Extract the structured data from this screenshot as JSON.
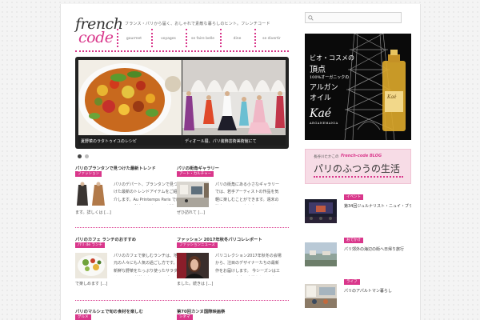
{
  "header": {
    "logo_line1": "french",
    "logo_line2": "code",
    "tagline": "フランス・パリから届く、おしゃれで素敵な暮らしのヒント。フレンチコード",
    "nav": [
      "gourmet",
      "voyages",
      "se faire belle",
      "dine",
      "se divertir"
    ]
  },
  "search": {
    "placeholder": ""
  },
  "slider": {
    "slides": [
      {
        "caption": "夏野菜のラタトゥイユのレシピ"
      },
      {
        "caption": "ディオール展、パリ装飾芸術美術館にて"
      }
    ]
  },
  "posts": [
    {
      "title": "パリのプランタンで見つけた最新トレンド",
      "category": "ファッション",
      "excerpt": "パリのデパート、プランタンで見つけた最新のトレンドアイテムをご紹介します。Au Printemps Paris では2017-18の秋冬コレクションが揃い、今年の注目アイテムがずらりと並んでい",
      "more": "ます。詳しくは",
      "more_link": "[...]"
    },
    {
      "title": "パリの街角ギャラリー",
      "category": "アート・カルチャー",
      "excerpt": "パリの街角にある小さなギャラリーでは、若手アーティストの作品を気軽に楽しむことができます。週末の散歩のついでに立ち寄ってみてはいかがでしょうか。入場無料の展示も多く",
      "more": "ぜひ訪れて",
      "more_link": "[...]"
    },
    {
      "title": "パリのカフェ ランチのおすすめ",
      "category": "パリ de ランチ",
      "excerpt": "パリのカフェで楽しむランチは、地元の人々にも人気の過ごし方です。 新鮮な野菜をたっぷり使ったサラダは12ユーロ前後から。テラス席でゆっくりと過ごす時間は19時頃ま",
      "more": "で楽しめます",
      "more_link": "[...]"
    },
    {
      "title": "ファッション 2017年秋冬パリコレレポート",
      "category": "ファッションニュース",
      "excerpt": "パリコレクション2017年秋冬の会場から、注目のデザイナーたちの最新作をお届けします。 今シーズンはエレガントで大人の女性らしいスタイルが主流となっており、多くのブランドがこぞって発表してい",
      "more": "ました。続きは",
      "more_link": "[...]"
    },
    {
      "title": "パリのマルシェで旬の食材を楽しむ",
      "category": "グルメ"
    },
    {
      "title": "第70回カンヌ国際映画祭",
      "category": "シネマ"
    }
  ],
  "ad": {
    "line1": "ビオ・コスメの",
    "line2": "頂点",
    "line3": "100%オーガニックの",
    "line4": "アルガン",
    "line5": "オイル",
    "brand": "Kaé",
    "brand_sub": "ARGANEMANIA",
    "bottle_label": "Kaé"
  },
  "blog": {
    "author": "長谷川たかこの",
    "name": "French-code BLOG",
    "title": "パリのふつうの生活"
  },
  "sidebar_posts": [
    {
      "category": "イベント",
      "title": "第34回ジュルナリスト・ニュイ・ブランシュ開催"
    },
    {
      "category": "おでかけ",
      "title": "パリ郊外の海辺の街へ日帰り旅行"
    },
    {
      "category": "ライフ",
      "title": "パリのアパルトマン暮らし"
    }
  ],
  "colors": {
    "accent": "#d9378b",
    "frame": "#222222"
  },
  "icons": {
    "search": "search-icon"
  }
}
